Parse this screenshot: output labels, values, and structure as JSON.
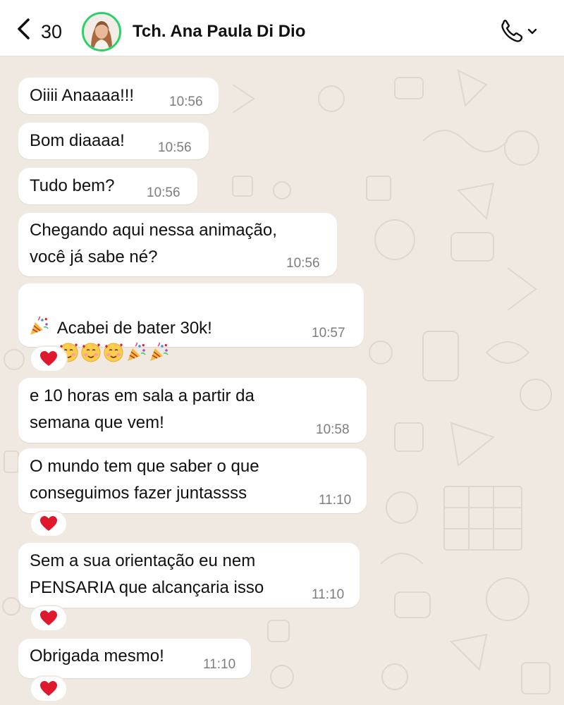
{
  "header": {
    "back_count": "30",
    "contact_name": "Tch. Ana Paula Di Dio"
  },
  "messages": [
    {
      "text": "Oiiii Anaaaa!!!",
      "time": "10:56"
    },
    {
      "text": "Bom diaaaa!",
      "time": "10:56"
    },
    {
      "text": "Tudo bem?",
      "time": "10:56"
    },
    {
      "text": "Chegando aqui nessa animação,\nvocê já sabe né?",
      "time": "10:56"
    },
    {
      "text": "Acabei de bater 30k!",
      "time": "10:57",
      "emojis": [
        "face-with-hearts",
        "face-with-hearts",
        "face-with-hearts",
        "party-popper",
        "party-popper",
        "party-popper"
      ],
      "reaction": "❤️"
    },
    {
      "text": "e 10 horas em sala a partir da\nsemana que vem!",
      "time": "10:58"
    },
    {
      "text": "O mundo tem que saber o que\nconseguimos fazer juntassss",
      "time": "11:10",
      "reaction": "❤️"
    },
    {
      "text": "Sem a sua orientação eu nem\nPENSARIA que alcançaria isso",
      "time": "11:10",
      "reaction": "❤️"
    },
    {
      "text": "Obrigada mesmo!",
      "time": "11:10",
      "reaction": "❤️"
    }
  ],
  "icons": {
    "back": "chevron-left-icon",
    "call": "phone-icon",
    "call_menu": "chevron-down-icon",
    "reaction": "red-heart-icon"
  },
  "colors": {
    "background": "#efe9e1",
    "bubble": "#ffffff",
    "timestamp": "#7d7d7d",
    "avatar_ring": "#25d366",
    "heart": "#e0182d"
  }
}
